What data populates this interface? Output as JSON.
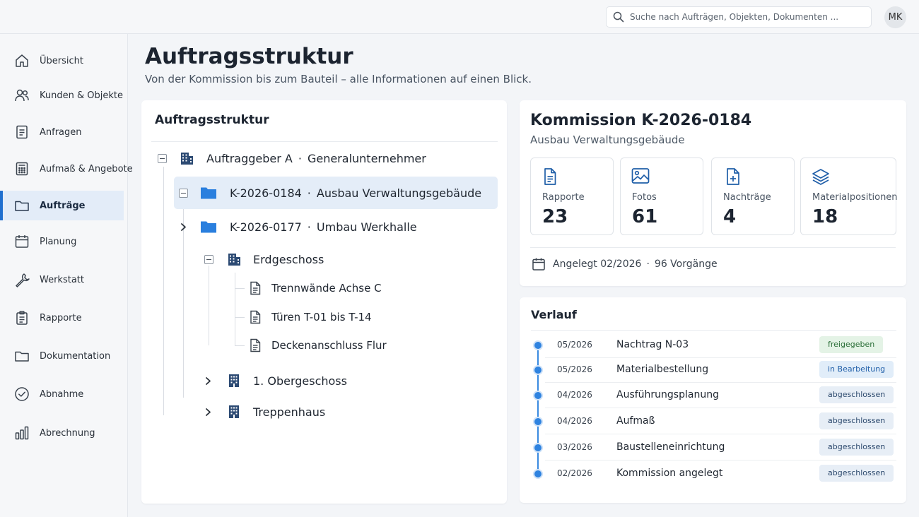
{
  "search": {
    "placeholder": "Suche nach Aufträgen, Objekten, Dokumenten ..."
  },
  "user": {
    "initials": "MK"
  },
  "sidebar": {
    "items": [
      {
        "label": "Übersicht",
        "icon": "home-icon"
      },
      {
        "label": "Kunden & Objekte",
        "icon": "users-icon"
      },
      {
        "label": "Anfragen",
        "icon": "document-icon"
      },
      {
        "label": "Aufmaß & Angebote",
        "icon": "calculator-icon"
      },
      {
        "label": "Aufträge",
        "icon": "folder-icon",
        "active": true
      },
      {
        "label": "Planung",
        "icon": "calendar-icon"
      },
      {
        "label": "Werkstatt",
        "icon": "wrench-icon"
      },
      {
        "label": "Rapporte",
        "icon": "clipboard-icon"
      },
      {
        "label": "Dokumentation",
        "icon": "folder-icon"
      },
      {
        "label": "Abnahme",
        "icon": "check-circle-icon"
      },
      {
        "label": "Abrechnung",
        "icon": "bar-chart-icon"
      }
    ]
  },
  "header": {
    "title": "Auftragsstruktur",
    "subtitle": "Von der Kommission bis zum Bauteil – alle Informationen auf einen Blick."
  },
  "tree": {
    "title": "Auftragsstruktur",
    "client": {
      "name": "Auftraggeber A",
      "type": "Generalunternehmer"
    },
    "commissions": [
      {
        "id": "K-2026-0184",
        "name": "Ausbau Verwaltungsgebäude",
        "expanded": true,
        "selected": true
      },
      {
        "id": "K-2026-0177",
        "name": "Umbau Werkhalle",
        "expanded": false
      }
    ],
    "floors": [
      {
        "name": "Erdgeschoss",
        "expanded": true,
        "items": [
          "Trennwände Achse C",
          "Türen T-01 bis T-14",
          "Deckenanschluss Flur"
        ]
      },
      {
        "name": "1. Obergeschoss",
        "expanded": false
      },
      {
        "name": "Treppenhaus",
        "expanded": false
      }
    ],
    "separator": "·"
  },
  "commission": {
    "title": "Kommission K-2026-0184",
    "subtitle": "Ausbau Verwaltungsgebäude",
    "stats": [
      {
        "label": "Rapporte",
        "value": "23",
        "icon": "document-icon"
      },
      {
        "label": "Fotos",
        "value": "61",
        "icon": "image-icon"
      },
      {
        "label": "Nachträge",
        "value": "4",
        "icon": "file-plus-icon"
      },
      {
        "label": "Materialpositionen",
        "value": "18",
        "icon": "layers-icon"
      }
    ],
    "created": "Angelegt 02/2026",
    "processes": "96 Vorgänge"
  },
  "timeline": {
    "title": "Verlauf",
    "entries": [
      {
        "date": "05/2026",
        "name": "Nachtrag N-03",
        "status": "freigegeben"
      },
      {
        "date": "05/2026",
        "name": "Materialbestellung",
        "status": "in Bearbeitung"
      },
      {
        "date": "04/2026",
        "name": "Ausführungsplanung",
        "status": "abgeschlossen"
      },
      {
        "date": "04/2026",
        "name": "Aufmaß",
        "status": "abgeschlossen"
      },
      {
        "date": "03/2026",
        "name": "Baustelleneinrichtung",
        "status": "abgeschlossen"
      },
      {
        "date": "02/2026",
        "name": "Kommission angelegt",
        "status": "abgeschlossen"
      }
    ]
  },
  "colors": {
    "accent": "#1f6fcf",
    "folder": "#2a7fde",
    "building": "#2c4a73"
  }
}
